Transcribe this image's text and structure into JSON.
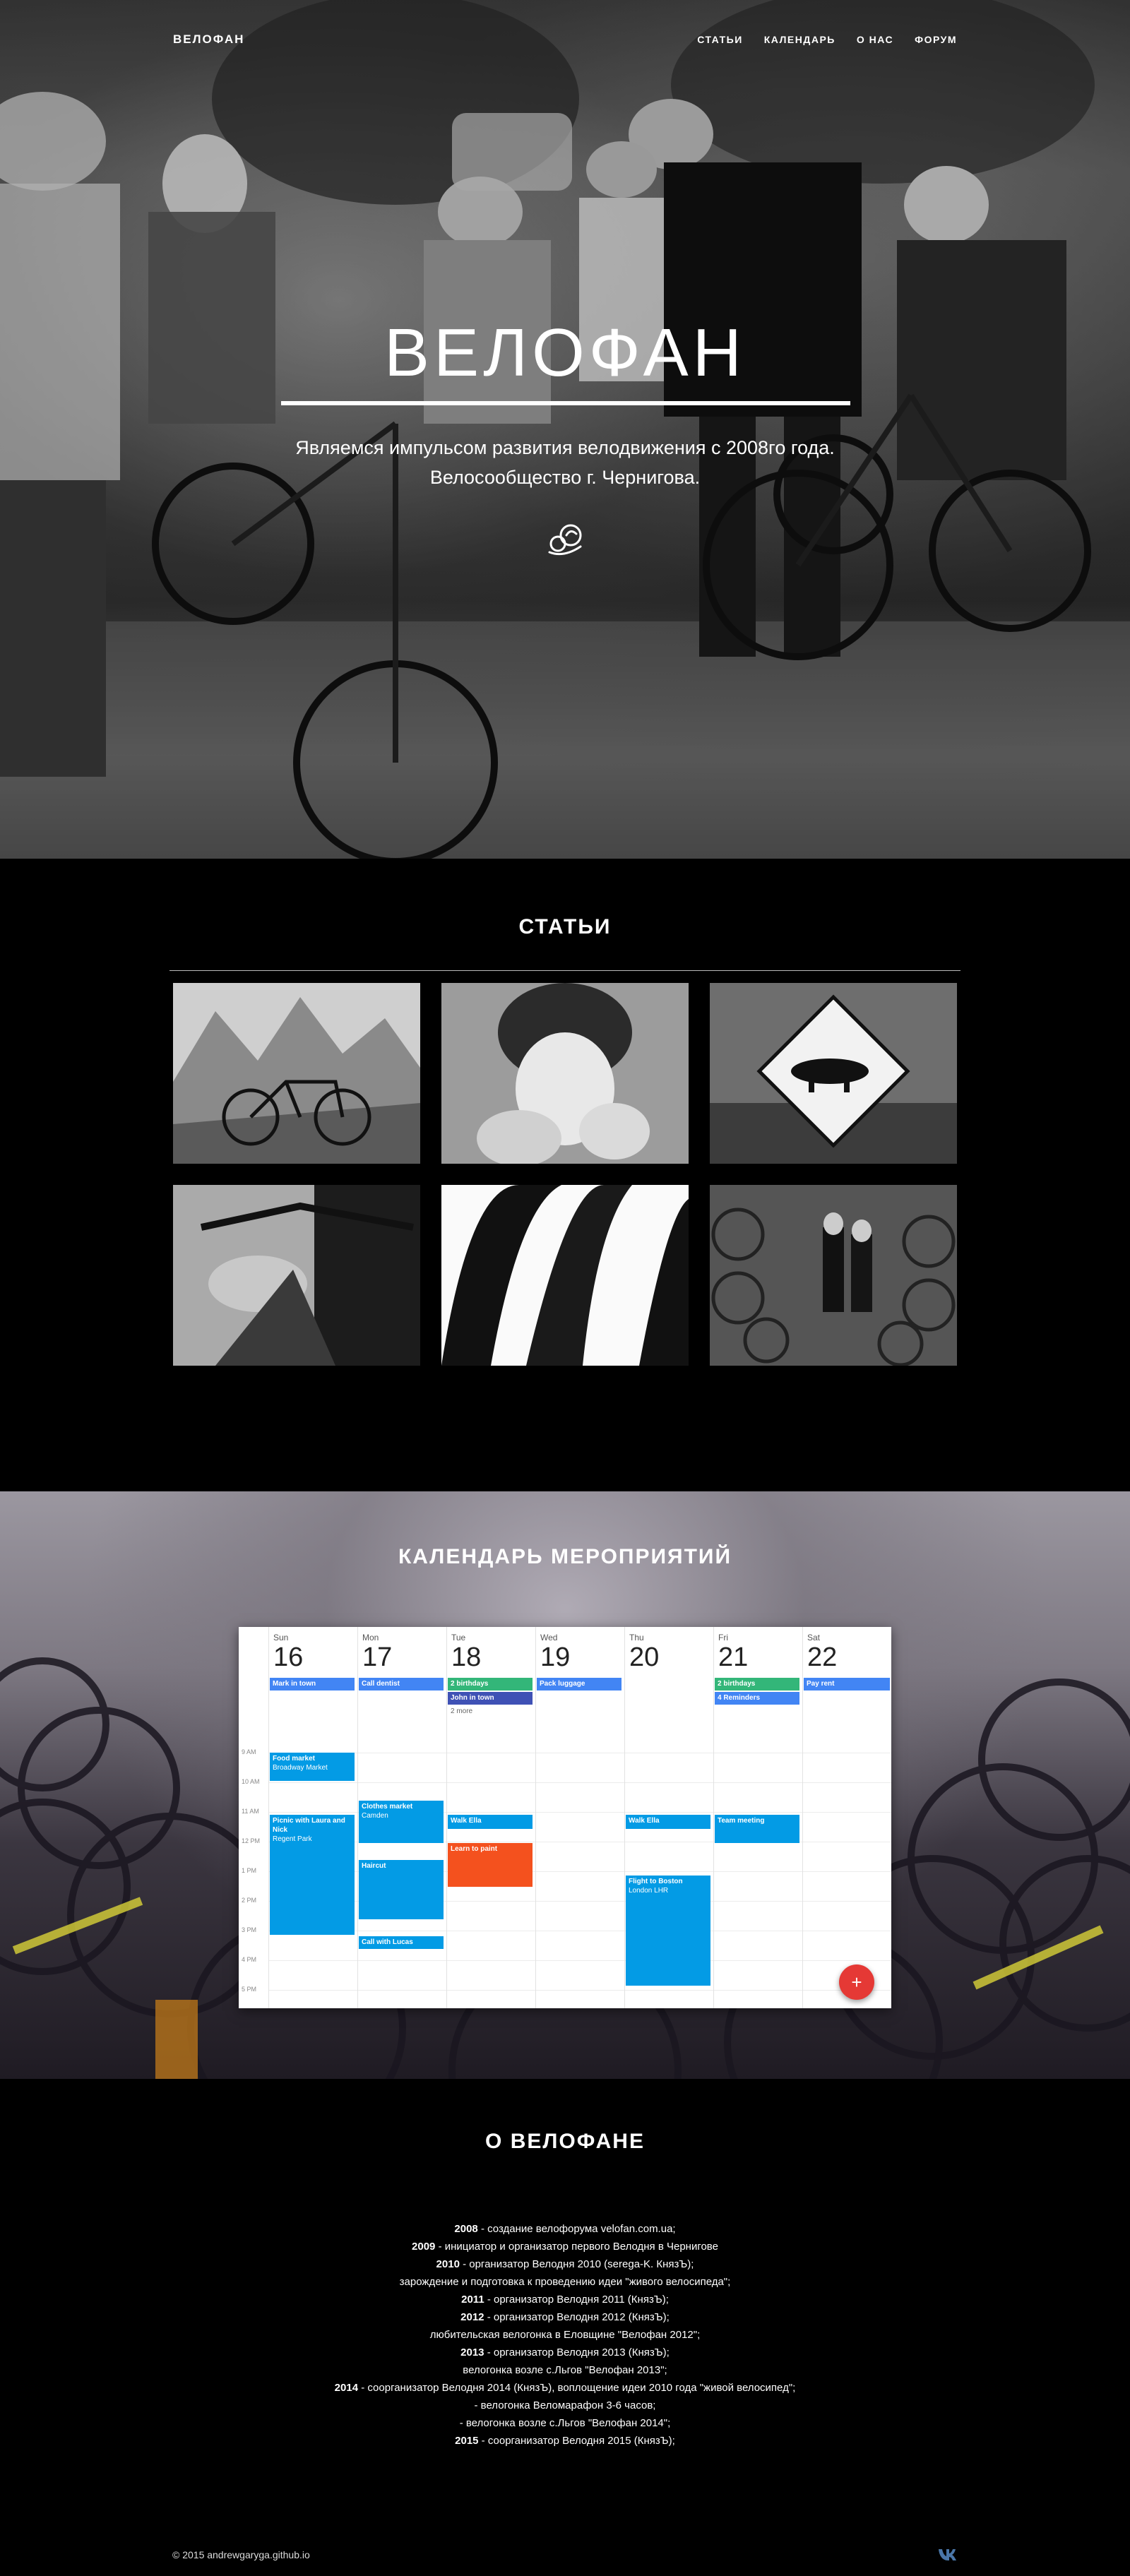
{
  "header": {
    "brand": "ВЕЛОФАН",
    "nav": [
      "СТАТЬИ",
      "КАЛЕНДАРЬ",
      "О НАС",
      "ФОРУМ"
    ]
  },
  "hero": {
    "title": "ВЕЛОФАН",
    "subtitle_line1": "Являемся импульсом развития велодвижения с 2008го года.",
    "subtitle_line2": "Велосообщество г. Чернигова.",
    "logo_icon": "bike-logo-icon"
  },
  "articles": {
    "title": "СТАТЬИ",
    "tiles": [
      "mountain-bike-photo",
      "child-helmet-photo",
      "road-sign-photo",
      "cyclist-closeup-photo",
      "tires-photo",
      "bike-parking-photo"
    ]
  },
  "calendar": {
    "title": "КАЛЕНДАРЬ МЕРОПРИЯТИЙ",
    "days": [
      {
        "name": "Sun",
        "num": "16"
      },
      {
        "name": "Mon",
        "num": "17"
      },
      {
        "name": "Tue",
        "num": "18"
      },
      {
        "name": "Wed",
        "num": "19"
      },
      {
        "name": "Thu",
        "num": "20"
      },
      {
        "name": "Fri",
        "num": "21"
      },
      {
        "name": "Sat",
        "num": "22"
      }
    ],
    "times": [
      "9 AM",
      "10 AM",
      "11 AM",
      "12 PM",
      "1 PM",
      "2 PM",
      "3 PM",
      "4 PM",
      "5 PM"
    ],
    "allday": {
      "sun": "Mark in town",
      "mon": "Call dentist",
      "tue1": "2 birthdays",
      "tue2": "John in town",
      "tue_more": "2 more",
      "wed": "Pack luggage",
      "fri1": "2 birthdays",
      "fri2": "4 Reminders",
      "sat": "Pay rent"
    },
    "events": {
      "food_title": "Food market",
      "food_sub": "Broadway Market",
      "picnic_title": "Picnic with Laura and Nick",
      "picnic_sub": "Regent Park",
      "clothes_title": "Clothes market",
      "clothes_sub": "Camden",
      "haircut": "Haircut",
      "call_lucas": "Call with Lucas",
      "walk_ella_tue": "Walk Ella",
      "learn_paint": "Learn to paint",
      "walk_ella_thu": "Walk Ella",
      "flight_title": "Flight to Boston",
      "flight_sub": "London LHR",
      "team_meeting": "Team meeting"
    },
    "fab_label": "+",
    "colors": {
      "blue": "#039be5",
      "teal": "#33b679",
      "indigo": "#3f51b5",
      "orange": "#f4511e",
      "light_blue": "#4285f4",
      "red": "#e53935"
    }
  },
  "about": {
    "title": "О ВЕЛОФАНЕ",
    "lines": [
      {
        "year": "2008",
        "text": " - создание велофорума velofan.com.ua;"
      },
      {
        "year": "2009",
        "text": " - инициатор и организатор первого Велодня в Чернигове"
      },
      {
        "year": "2010",
        "text": " - организатор Велодня 2010 (serega-K. КнязЪ);"
      },
      {
        "year": "",
        "text": "зарождение и подготовка к проведению идеи \"живого велосипеда\";"
      },
      {
        "year": "2011",
        "text": " - организатор Велодня 2011 (КнязЪ);"
      },
      {
        "year": "2012",
        "text": " - организатор Велодня 2012 (КнязЪ);"
      },
      {
        "year": "",
        "text": "любительская велогонка в Еловщине \"Велофан 2012\";"
      },
      {
        "year": "2013",
        "text": " - организатор Велодня 2013 (КнязЪ);"
      },
      {
        "year": "",
        "text": "велогонка возле с.Льгов \"Велофан 2013\";"
      },
      {
        "year": "2014",
        "text": " - соорганизатор Велодня 2014 (КнязЪ), воплощение идеи 2010 года \"живой велосипед\";"
      },
      {
        "year": "",
        "text": "- велогонка Веломарафон 3-6 часов;"
      },
      {
        "year": "",
        "text": "- велогонка возле с.Льгов \"Велофан 2014\";"
      },
      {
        "year": "2015",
        "text": " - соорганизатор Велодня 2015 (КнязЪ);"
      }
    ]
  },
  "footer": {
    "copyright": "© 2015 andrewgaryga.github.io",
    "social_icon": "vk-icon"
  }
}
